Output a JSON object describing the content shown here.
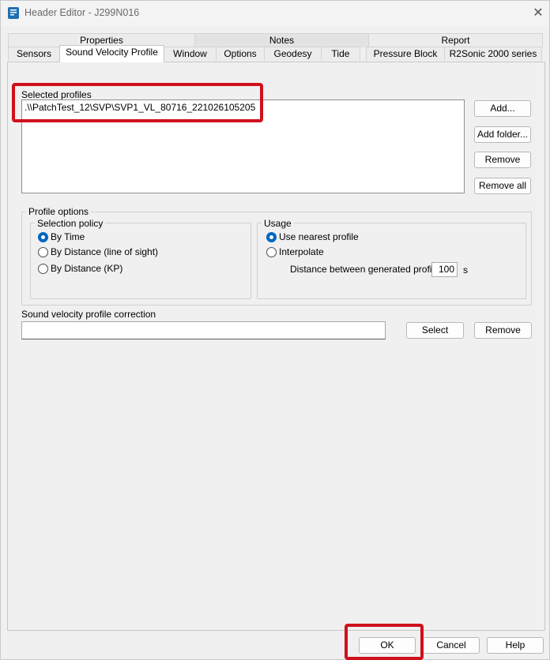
{
  "window": {
    "title": "Header Editor - J299N016",
    "close_glyph": "✕"
  },
  "tabs": {
    "back_row": [
      "Properties",
      "Notes",
      "Report"
    ],
    "front_row": [
      "Sensors",
      "Sound Velocity Profile",
      "Window",
      "Options",
      "Geodesy",
      "Tide",
      "Pressure Block",
      "R2Sonic 2000 series"
    ],
    "active": "Sound Velocity Profile"
  },
  "selected_profiles": {
    "label": "Selected profiles",
    "items": [
      ".\\\\PatchTest_12\\SVP\\SVP1_VL_80716_221026105205"
    ],
    "buttons": {
      "add": "Add...",
      "add_folder": "Add folder...",
      "remove": "Remove",
      "remove_all": "Remove all"
    }
  },
  "profile_options": {
    "caption": "Profile options",
    "selection_policy": {
      "caption": "Selection policy",
      "options": [
        "By Time",
        "By Distance (line of sight)",
        "By Distance (KP)"
      ],
      "selected": "By Time"
    },
    "usage": {
      "caption": "Usage",
      "options": [
        "Use nearest profile",
        "Interpolate"
      ],
      "selected": "Use nearest profile",
      "distance_label": "Distance between generated profiles",
      "distance_value": "100",
      "distance_unit": "s"
    }
  },
  "svp_correction": {
    "label": "Sound velocity profile correction",
    "value": "",
    "select_button": "Select",
    "remove_button": "Remove"
  },
  "footer": {
    "ok": "OK",
    "cancel": "Cancel",
    "help": "Help"
  },
  "colors": {
    "highlight": "#d0101c",
    "radio_accent": "#0067c0",
    "window_bg": "#f0f0f0"
  }
}
